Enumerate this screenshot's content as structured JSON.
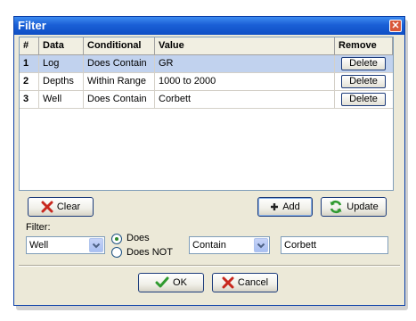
{
  "window": {
    "title": "Filter"
  },
  "table": {
    "headers": [
      "#",
      "Data",
      "Conditional",
      "Value",
      "Remove"
    ],
    "rows": [
      {
        "num": "1",
        "data": "Log",
        "conditional": "Does Contain",
        "value": "GR",
        "remove": "Delete"
      },
      {
        "num": "2",
        "data": "Depths",
        "conditional": "Within Range",
        "value": "1000 to 2000",
        "remove": "Delete"
      },
      {
        "num": "3",
        "data": "Well",
        "conditional": "Does Contain",
        "value": "Corbett",
        "remove": "Delete"
      }
    ]
  },
  "buttons": {
    "clear": "Clear",
    "add": "Add",
    "update": "Update",
    "ok": "OK",
    "cancel": "Cancel"
  },
  "filter": {
    "label": "Filter:",
    "data_select": "Well",
    "radio_does": "Does",
    "radio_does_not": "Does NOT",
    "conditional_select": "Contain",
    "value": "Corbett"
  },
  "colors": {
    "title_bar": "#1a5fd6",
    "selected_row": "#c1d2ee",
    "clear_x": "#c8281e",
    "ok_check": "#2f9a2f"
  }
}
